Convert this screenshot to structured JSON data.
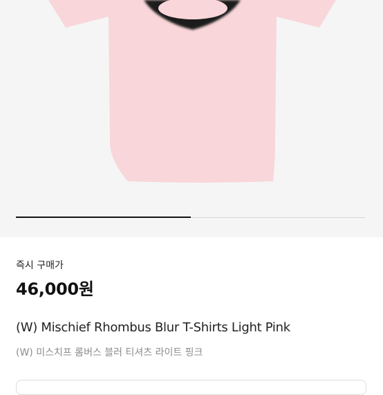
{
  "product": {
    "image_alt": "Mischief Rhombus Blur T-Shirts Light Pink",
    "image_colors": {
      "background": "#f5f5f5",
      "shirt": "#f8d6d9",
      "graphic": "#1a1a1a"
    },
    "gallery_progress": 0.5,
    "instant_buy_label": "즉시 구매가",
    "price": "46,000원",
    "title_en": "(W) Mischief Rhombus Blur T-Shirts Light Pink",
    "title_ko": "(W) 미스치프 롬버스 블러 티셔츠 라이트 핑크"
  }
}
